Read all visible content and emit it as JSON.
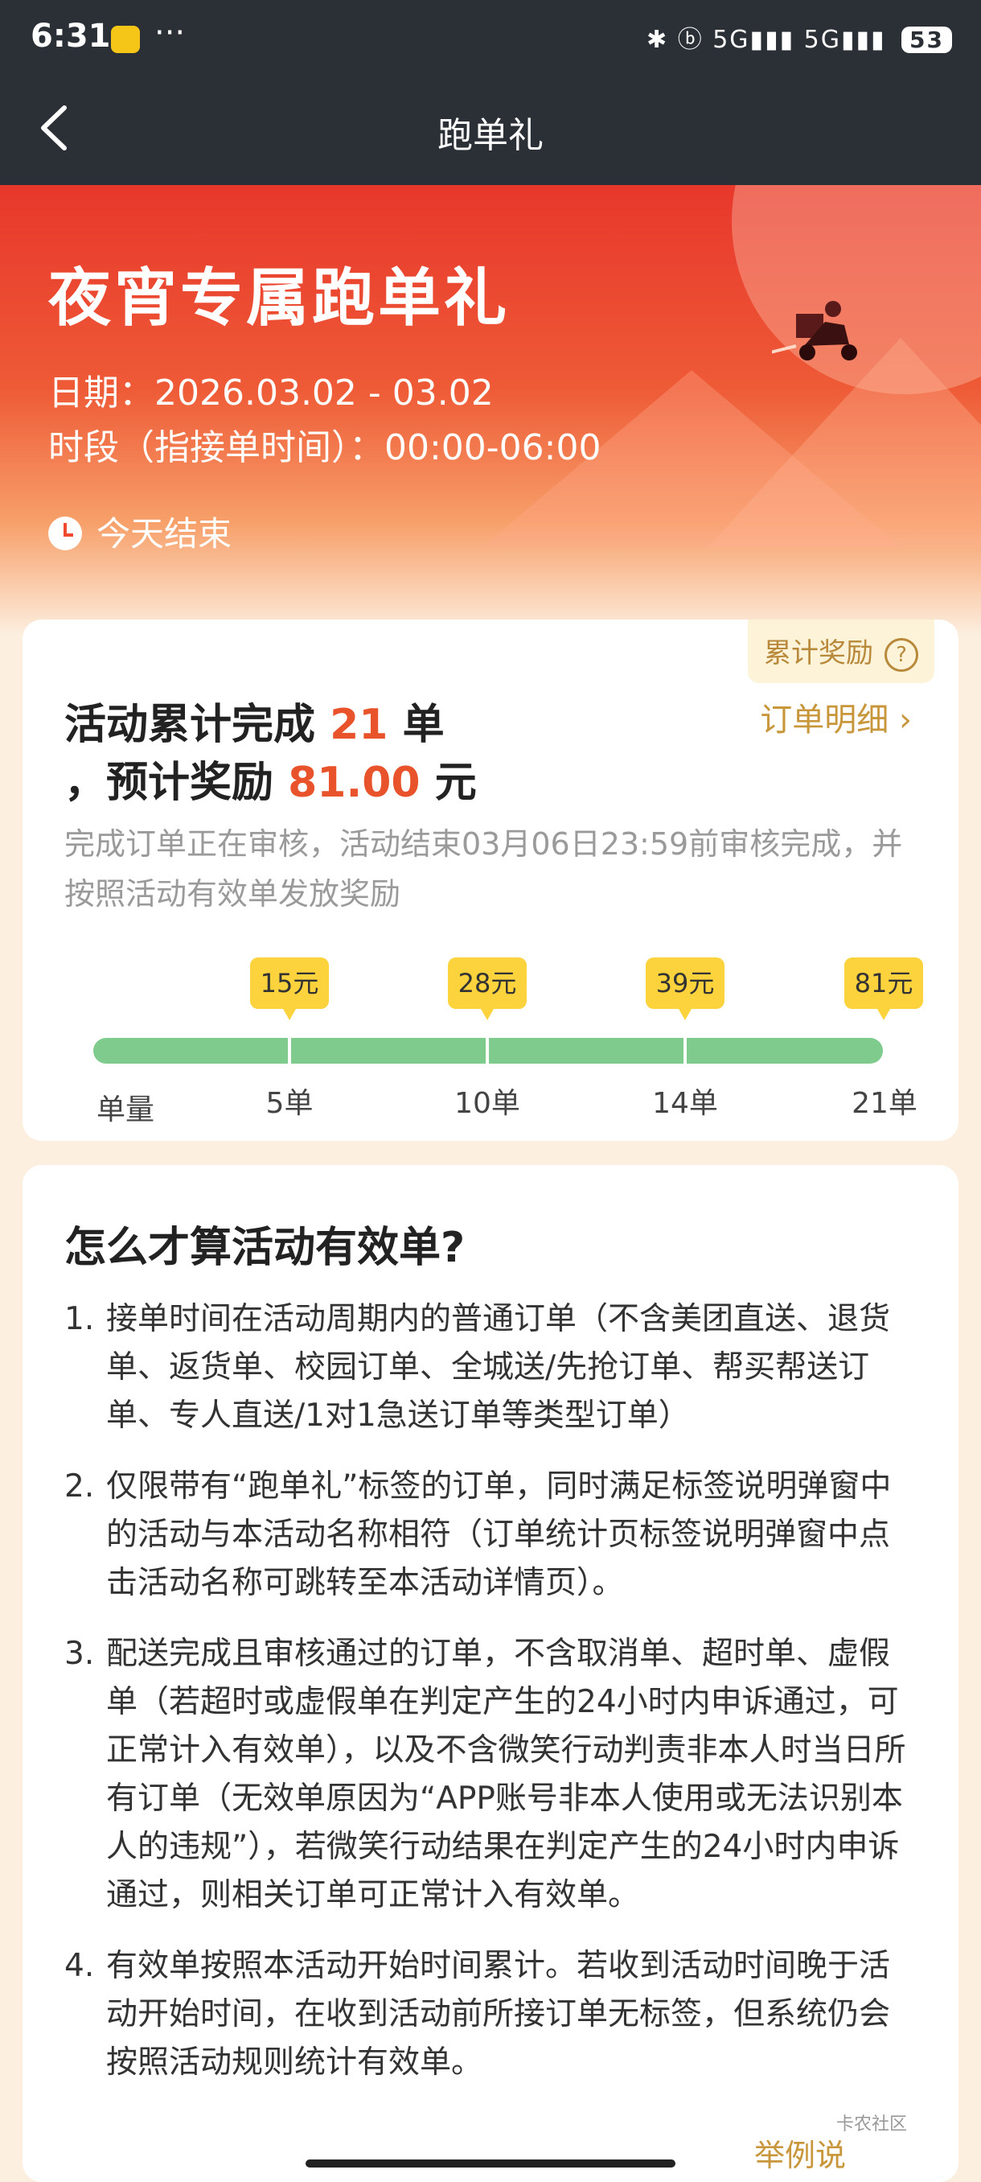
{
  "status_bar": {
    "time": "6:31",
    "dots": "···",
    "indicators": "✱ ⓑ 5G▮▮▮ 5G▮▮▮",
    "battery": "53"
  },
  "nav": {
    "title": "跑单礼"
  },
  "hero": {
    "title": "夜宵专属跑单礼",
    "date_line": "日期：2026.03.02 - 03.02",
    "time_line": "时段（指接单时间）：00:00-06:00",
    "ends": "今天结束"
  },
  "summary": {
    "badge": "累计奖励",
    "line1_prefix": "活动累计完成 ",
    "orders": "21",
    "line1_suffix": " 单",
    "line2_prefix": "，预计奖励 ",
    "reward": "81.00",
    "line2_suffix": " 元",
    "detail_link": "订单明细 ›",
    "note": "完成订单正在审核，活动结束03月06日23:59前审核完成，并按照活动有效单发放奖励"
  },
  "progress": {
    "qty_label": "单量",
    "milestones": [
      {
        "orders": "5单",
        "reward": "15元"
      },
      {
        "orders": "10单",
        "reward": "28元"
      },
      {
        "orders": "14单",
        "reward": "39元"
      },
      {
        "orders": "21单",
        "reward": "81元"
      }
    ],
    "completed_fraction": 1.0
  },
  "rules": {
    "title": "怎么才算活动有效单?",
    "items": [
      {
        "n": "1.",
        "text": "接单时间在活动周期内的普通订单（不含美团直送、退货单、返货单、校园订单、全城送/先抢订单、帮买帮送订单、专人直送/1对1急送订单等类型订单）"
      },
      {
        "n": "2.",
        "text": "仅限带有“跑单礼”标签的订单，同时满足标签说明弹窗中的活动与本活动名称相符（订单统计页标签说明弹窗中点击活动名称可跳转至本活动详情页）。"
      },
      {
        "n": "3.",
        "text": "配送完成且审核通过的订单，不含取消单、超时单、虚假单（若超时或虚假单在判定产生的24小时内申诉通过，可正常计入有效单），以及不含微笑行动判责非本人时当日所有订单（无效单原因为“APP账号非本人使用或无法识别本人的违规”），若微笑行动结果在判定产生的24小时内申诉通过，则相关订单可正常计入有效单。"
      },
      {
        "n": "4.",
        "text": "有效单按照本活动开始时间累计。若收到活动时间晚于活动开始时间，在收到活动前所接订单无标签，但系统仍会按照活动规则统计有效单。"
      }
    ],
    "example_link": "举例说"
  },
  "watermark": "卡农社区"
}
